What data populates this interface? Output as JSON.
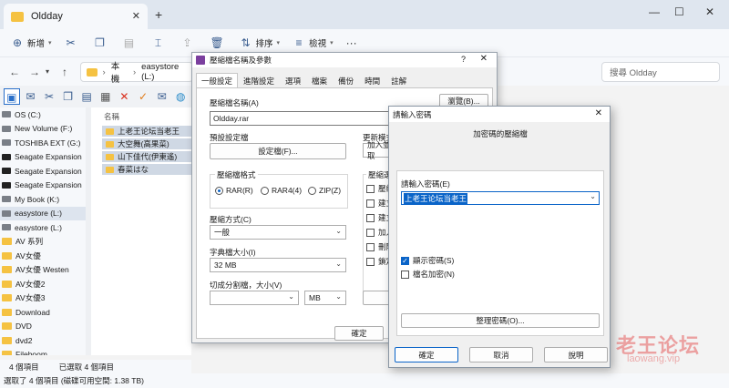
{
  "explorer": {
    "tab_title": "Oldday",
    "close_glyph": "✕",
    "new_tab_glyph": "+",
    "window_controls": {
      "minimize": "—",
      "maximize": "☐",
      "close": "✕"
    },
    "cmdbar": {
      "new_label": "新增",
      "sort_label": "排序",
      "view_label": "檢視",
      "more_label": "···"
    },
    "address": {
      "crumb1": "本機",
      "crumb2": "easystore (L:)",
      "sep": "›"
    },
    "search_placeholder": "搜尋 Oldday",
    "sidebar": [
      {
        "label": "OS (C:)",
        "kind": "drv"
      },
      {
        "label": "New Volume (F:)",
        "kind": "drv"
      },
      {
        "label": "TOSHIBA EXT (G:)",
        "kind": "drv"
      },
      {
        "label": "Seagate Expansion",
        "kind": "drvdark"
      },
      {
        "label": "Seagate Expansion",
        "kind": "drvdark"
      },
      {
        "label": "Seagate Expansion",
        "kind": "drvdark"
      },
      {
        "label": "My Book (K:)",
        "kind": "drv"
      },
      {
        "label": "easystore (L:)",
        "kind": "drv",
        "active": true
      },
      {
        "label": "easystore (L:)",
        "kind": "drv"
      },
      {
        "label": "AV 系列",
        "kind": "fld"
      },
      {
        "label": "AV女優",
        "kind": "fld"
      },
      {
        "label": "AV女優 Westen",
        "kind": "fld"
      },
      {
        "label": "AV女優2",
        "kind": "fld"
      },
      {
        "label": "AV女優3",
        "kind": "fld"
      },
      {
        "label": "Download",
        "kind": "fld"
      },
      {
        "label": "DVD",
        "kind": "fld"
      },
      {
        "label": "dvd2",
        "kind": "fld"
      },
      {
        "label": "Fileboom",
        "kind": "fld"
      }
    ],
    "col_name": "名稱",
    "files": [
      "上老王论坛当老王",
      "大空舞(高果菜)",
      "山下佳代(伊東遙)",
      "春菜はな"
    ],
    "status_items": "4 個項目",
    "status_selected": "已選取 4 個項目",
    "statusbar_text": "選取了 4 個項目 (磁碟可用空間: 1.38 TB)"
  },
  "archive_dialog": {
    "title": "壓縮檔名稱及參數",
    "help_glyph": "?",
    "close_glyph": "✕",
    "tabs": [
      "一般設定",
      "進階設定",
      "選項",
      "檔案",
      "備份",
      "時間",
      "註解"
    ],
    "archive_name_label": "壓縮檔名稱(A)",
    "archive_name_value": "Oldday.rar",
    "browse_label": "瀏覽(B)...",
    "profile_label": "預設設定檔",
    "profile_button": "設定檔(F)...",
    "update_mode_label": "更新模式",
    "update_mode_value": "加入並取",
    "format_group_label": "壓縮檔格式",
    "format_options": [
      "RAR(R)",
      "RAR4(4)",
      "ZIP(Z)"
    ],
    "options_group_label": "壓縮選",
    "option_checks": [
      "壓縮",
      "建立",
      "建立",
      "加入",
      "刪除",
      "鎖定"
    ],
    "method_label": "壓縮方式(C)",
    "method_value": "一般",
    "dict_label": "字典檔大小(I)",
    "dict_value": "32 MB",
    "split_label": "切成分割檔，大小(V)",
    "split_value": "",
    "split_unit": "MB",
    "ok_label": "確定"
  },
  "password_dialog": {
    "title": "請輸入密碼",
    "close_glyph": "✕",
    "subtitle": "加密碼的壓縮檔",
    "enter_label": "請輸入密碼(E)",
    "password_value": "上老王论坛当老王",
    "show_password_label": "顯示密碼(S)",
    "show_password_checked": true,
    "encrypt_names_label": "檔名加密(N)",
    "encrypt_names_checked": false,
    "organize_label": "整理密碼(O)...",
    "ok_label": "確定",
    "cancel_label": "取消",
    "help_label": "說明"
  },
  "watermark": {
    "text": "老王论坛",
    "url": "laowang.vip"
  }
}
